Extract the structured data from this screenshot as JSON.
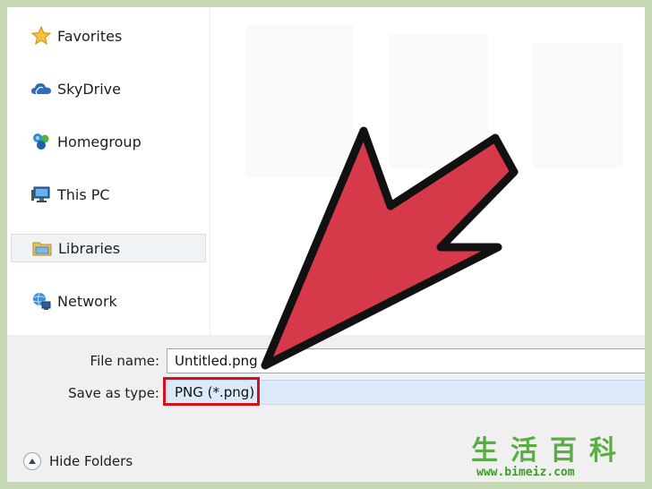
{
  "nav": {
    "items": [
      {
        "label": "Favorites",
        "icon": "star-icon"
      },
      {
        "label": "SkyDrive",
        "icon": "cloud-icon"
      },
      {
        "label": "Homegroup",
        "icon": "homegroup-icon"
      },
      {
        "label": "This PC",
        "icon": "computer-icon"
      },
      {
        "label": "Libraries",
        "icon": "libraries-folder-icon",
        "selected": true
      },
      {
        "label": "Network",
        "icon": "network-icon"
      }
    ]
  },
  "form": {
    "file_name_label": "File name:",
    "file_name_value": "Untitled.png",
    "save_type_label": "Save as type:",
    "save_type_value": "PNG (*.png)"
  },
  "footer": {
    "hide_folders_label": "Hide Folders"
  },
  "watermark": {
    "chars": "生活百科",
    "url": "www.bimeiz.com"
  },
  "colors": {
    "arrow_fill": "#d6394a",
    "highlight_border": "#d3101c",
    "selected_field": "#dbe9f9"
  }
}
